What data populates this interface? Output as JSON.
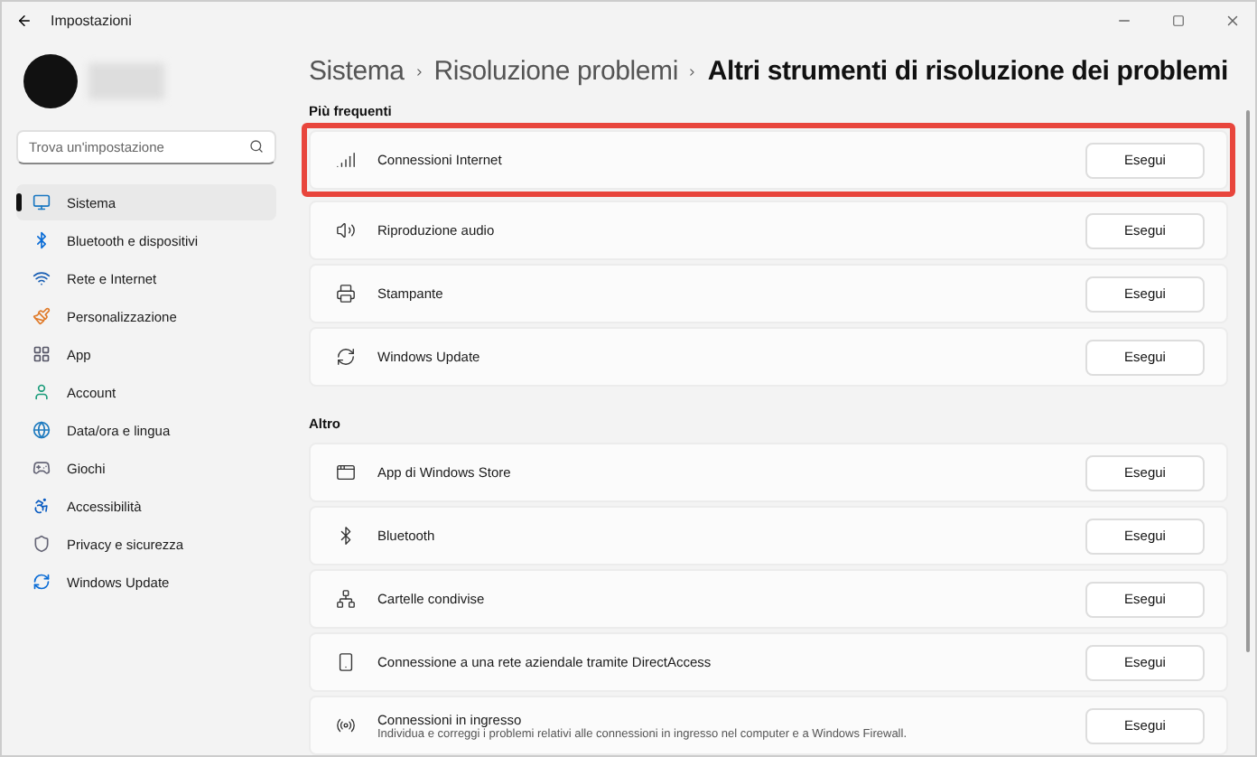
{
  "window": {
    "title": "Impostazioni"
  },
  "search": {
    "placeholder": "Trova un'impostazione"
  },
  "sidebar": {
    "items": [
      {
        "label": "Sistema",
        "selected": true
      },
      {
        "label": "Bluetooth e dispositivi",
        "selected": false
      },
      {
        "label": "Rete e Internet",
        "selected": false
      },
      {
        "label": "Personalizzazione",
        "selected": false
      },
      {
        "label": "App",
        "selected": false
      },
      {
        "label": "Account",
        "selected": false
      },
      {
        "label": "Data/ora e lingua",
        "selected": false
      },
      {
        "label": "Giochi",
        "selected": false
      },
      {
        "label": "Accessibilità",
        "selected": false
      },
      {
        "label": "Privacy e sicurezza",
        "selected": false
      },
      {
        "label": "Windows Update",
        "selected": false
      }
    ]
  },
  "breadcrumb": [
    "Sistema",
    "Risoluzione problemi",
    "Altri strumenti di risoluzione dei problemi"
  ],
  "sections": [
    {
      "title": "Più frequenti",
      "rows": [
        {
          "label": "Connessioni Internet",
          "button": "Esegui",
          "highlighted": true
        },
        {
          "label": "Riproduzione audio",
          "button": "Esegui",
          "highlighted": false
        },
        {
          "label": "Stampante",
          "button": "Esegui",
          "highlighted": false
        },
        {
          "label": "Windows Update",
          "button": "Esegui",
          "highlighted": false
        }
      ]
    },
    {
      "title": "Altro",
      "rows": [
        {
          "label": "App di Windows Store",
          "button": "Esegui",
          "highlighted": false
        },
        {
          "label": "Bluetooth",
          "button": "Esegui",
          "highlighted": false
        },
        {
          "label": "Cartelle condivise",
          "button": "Esegui",
          "highlighted": false
        },
        {
          "label": "Connessione a una rete aziendale tramite DirectAccess",
          "button": "Esegui",
          "highlighted": false
        },
        {
          "label": "Connessioni in ingresso",
          "description": "Individua e correggi i problemi relativi alle connessioni in ingresso nel computer e a Windows Firewall.",
          "button": "Esegui",
          "highlighted": false
        }
      ]
    }
  ]
}
